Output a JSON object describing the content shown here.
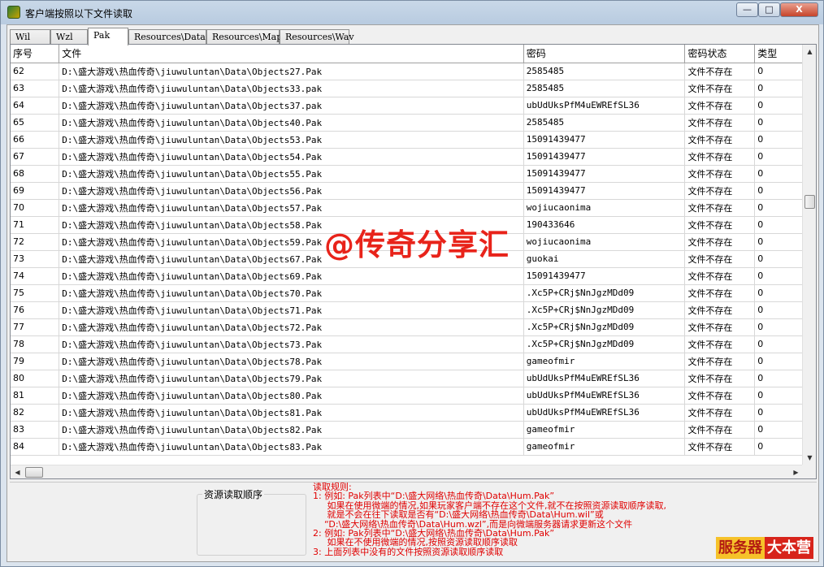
{
  "window": {
    "title": "客户端按照以下文件读取",
    "buttons": {
      "minimize": "—",
      "maximize": "□",
      "close": "X"
    }
  },
  "tabs": [
    {
      "label": "Wil",
      "active": false
    },
    {
      "label": "Wzl",
      "active": false
    },
    {
      "label": "Pak",
      "active": true
    },
    {
      "label": "Resources\\Data",
      "active": false
    },
    {
      "label": "Resources\\Map",
      "active": false
    },
    {
      "label": "Resources\\Wav",
      "active": false
    }
  ],
  "table": {
    "columns": [
      "序号",
      "文件",
      "密码",
      "密码状态",
      "类型"
    ],
    "rows": [
      [
        "62",
        "D:\\盛大游戏\\热血传奇\\jiuwuluntan\\Data\\Objects27.Pak",
        "2585485",
        "文件不存在",
        "0"
      ],
      [
        "63",
        "D:\\盛大游戏\\热血传奇\\jiuwuluntan\\Data\\Objects33.pak",
        "2585485",
        "文件不存在",
        "0"
      ],
      [
        "64",
        "D:\\盛大游戏\\热血传奇\\jiuwuluntan\\Data\\Objects37.pak",
        "ubUdUksPfM4uEWREfSL36",
        "文件不存在",
        "0"
      ],
      [
        "65",
        "D:\\盛大游戏\\热血传奇\\jiuwuluntan\\Data\\Objects40.Pak",
        "2585485",
        "文件不存在",
        "0"
      ],
      [
        "66",
        "D:\\盛大游戏\\热血传奇\\jiuwuluntan\\Data\\Objects53.Pak",
        "15091439477",
        "文件不存在",
        "0"
      ],
      [
        "67",
        "D:\\盛大游戏\\热血传奇\\jiuwuluntan\\Data\\Objects54.Pak",
        "15091439477",
        "文件不存在",
        "0"
      ],
      [
        "68",
        "D:\\盛大游戏\\热血传奇\\jiuwuluntan\\Data\\Objects55.Pak",
        "15091439477",
        "文件不存在",
        "0"
      ],
      [
        "69",
        "D:\\盛大游戏\\热血传奇\\jiuwuluntan\\Data\\Objects56.Pak",
        "15091439477",
        "文件不存在",
        "0"
      ],
      [
        "70",
        "D:\\盛大游戏\\热血传奇\\jiuwuluntan\\Data\\Objects57.Pak",
        "wojiucaonima",
        "文件不存在",
        "0"
      ],
      [
        "71",
        "D:\\盛大游戏\\热血传奇\\jiuwuluntan\\Data\\Objects58.Pak",
        "190433646",
        "文件不存在",
        "0"
      ],
      [
        "72",
        "D:\\盛大游戏\\热血传奇\\jiuwuluntan\\Data\\Objects59.Pak",
        "wojiucaonima",
        "文件不存在",
        "0"
      ],
      [
        "73",
        "D:\\盛大游戏\\热血传奇\\jiuwuluntan\\Data\\Objects67.Pak",
        "guokai",
        "文件不存在",
        "0"
      ],
      [
        "74",
        "D:\\盛大游戏\\热血传奇\\jiuwuluntan\\Data\\Objects69.Pak",
        "15091439477",
        "文件不存在",
        "0"
      ],
      [
        "75",
        "D:\\盛大游戏\\热血传奇\\jiuwuluntan\\Data\\Objects70.Pak",
        ".Xc5P+CRj$NnJgzMDd09",
        "文件不存在",
        "0"
      ],
      [
        "76",
        "D:\\盛大游戏\\热血传奇\\jiuwuluntan\\Data\\Objects71.Pak",
        ".Xc5P+CRj$NnJgzMDd09",
        "文件不存在",
        "0"
      ],
      [
        "77",
        "D:\\盛大游戏\\热血传奇\\jiuwuluntan\\Data\\Objects72.Pak",
        ".Xc5P+CRj$NnJgzMDd09",
        "文件不存在",
        "0"
      ],
      [
        "78",
        "D:\\盛大游戏\\热血传奇\\jiuwuluntan\\Data\\Objects73.Pak",
        ".Xc5P+CRj$NnJgzMDd09",
        "文件不存在",
        "0"
      ],
      [
        "79",
        "D:\\盛大游戏\\热血传奇\\jiuwuluntan\\Data\\Objects78.Pak",
        "gameofmir",
        "文件不存在",
        "0"
      ],
      [
        "80",
        "D:\\盛大游戏\\热血传奇\\jiuwuluntan\\Data\\Objects79.Pak",
        "ubUdUksPfM4uEWREfSL36",
        "文件不存在",
        "0"
      ],
      [
        "81",
        "D:\\盛大游戏\\热血传奇\\jiuwuluntan\\Data\\Objects80.Pak",
        "ubUdUksPfM4uEWREfSL36",
        "文件不存在",
        "0"
      ],
      [
        "82",
        "D:\\盛大游戏\\热血传奇\\jiuwuluntan\\Data\\Objects81.Pak",
        "ubUdUksPfM4uEWREfSL36",
        "文件不存在",
        "0"
      ],
      [
        "83",
        "D:\\盛大游戏\\热血传奇\\jiuwuluntan\\Data\\Objects82.Pak",
        "gameofmir",
        "文件不存在",
        "0"
      ],
      [
        "84",
        "D:\\盛大游戏\\热血传奇\\jiuwuluntan\\Data\\Objects83.Pak",
        "gameofmir",
        "文件不存在",
        "0"
      ]
    ]
  },
  "group_box": {
    "title": "资源读取顺序"
  },
  "rules": {
    "lines": [
      "读取规则:",
      "1: 例如: Pak列表中“D:\\盛大网络\\热血传奇\\Data\\Hum.Pak”",
      "     如果在使用微端的情况,如果玩家客户端不存在这个文件,就不在按照资源读取顺序读取,",
      "     就是不会在往下读取是否有“D:\\盛大网络\\热血传奇\\Data\\Hum.wil”或",
      "    “D:\\盛大网络\\热血传奇\\Data\\Hum.wzl”,而是向微端服务器请求更新这个文件",
      "2: 例如: Pak列表中“D:\\盛大网络\\热血传奇\\Data\\Hum.Pak”",
      "     如果在不使用微端的情况,按照资源读取顺序读取",
      "3: 上面列表中没有的文件按照资源读取顺序读取"
    ]
  },
  "watermark": "@传奇分享汇",
  "logo": {
    "part1": "服务器",
    "part2": "大本营"
  }
}
